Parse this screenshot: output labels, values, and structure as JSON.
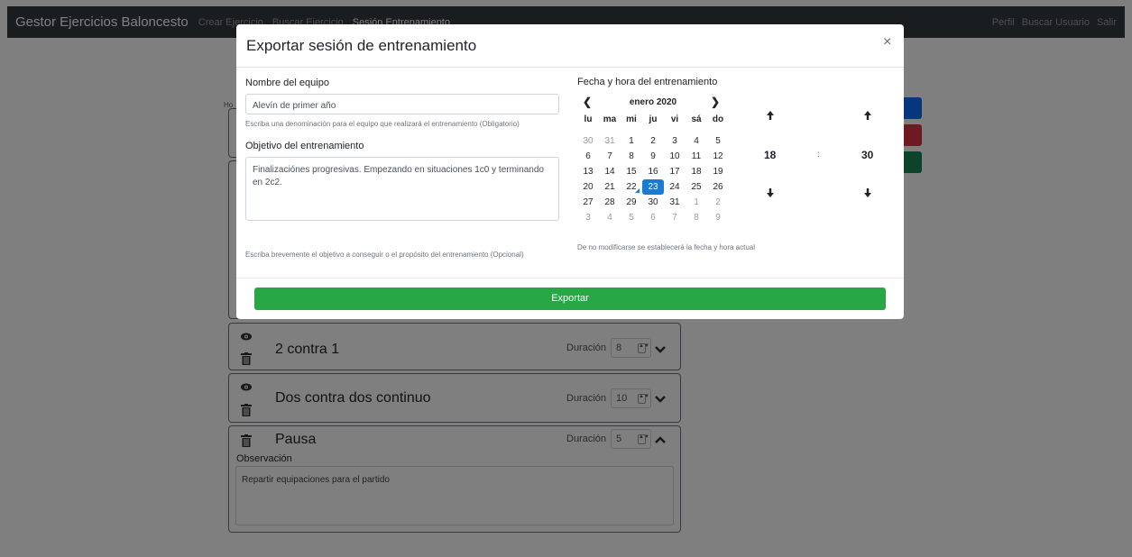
{
  "navbar": {
    "brand": "Gestor Ejercicios Baloncesto",
    "links": [
      "Crear Ejercicio",
      "Buscar Ejercicio",
      "Sesión Entrenamiento"
    ],
    "right_links": [
      "Perfil",
      "Buscar Usuario",
      "Salir"
    ]
  },
  "background": {
    "partial_label": "Ho",
    "cards": [
      {
        "title": "2 contra 1",
        "duration_label": "Duración",
        "duration": "8"
      },
      {
        "title": "Dos contra dos continuo",
        "duration_label": "Duración",
        "duration": "10"
      },
      {
        "title": "Pausa",
        "duration_label": "Duración",
        "duration": "5",
        "observation_label": "Observación",
        "observation": "Repartir equipaciones para el partido"
      }
    ]
  },
  "modal": {
    "title": "Exportar sesión de entrenamiento",
    "close": "×",
    "team_label": "Nombre del equipo",
    "team_value": "Alevín de primer año",
    "team_help": "Escriba una denominación para el equipo que realizará el entrenamiento (Obligatorio)",
    "objective_label": "Objetivo del entrenamiento",
    "objective_value": "Finalizaciónes progresivas. Empezando en situaciones 1c0 y terminando en 2c2.",
    "objective_help": "Escriba brevemente el objetivo a conseguir o el propósito del entrenamiento (Opcional)",
    "date_label": "Fecha y hora del entrenamiento",
    "month": "enero 2020",
    "weekdays": [
      "lu",
      "ma",
      "mi",
      "ju",
      "vi",
      "sá",
      "do"
    ],
    "weeks": [
      [
        "30",
        "31",
        "1",
        "2",
        "3",
        "4",
        "5"
      ],
      [
        "6",
        "7",
        "8",
        "9",
        "10",
        "11",
        "12"
      ],
      [
        "13",
        "14",
        "15",
        "16",
        "17",
        "18",
        "19"
      ],
      [
        "20",
        "21",
        "22",
        "23",
        "24",
        "25",
        "26"
      ],
      [
        "27",
        "28",
        "29",
        "30",
        "31",
        "1",
        "2"
      ],
      [
        "3",
        "4",
        "5",
        "6",
        "7",
        "8",
        "9"
      ]
    ],
    "selected_day": "23",
    "hour": "18",
    "minute": "30",
    "time_sep": ":",
    "date_help": "De no modificarse se establecerá la fecha y hora actual",
    "export_button": "Exportar"
  }
}
